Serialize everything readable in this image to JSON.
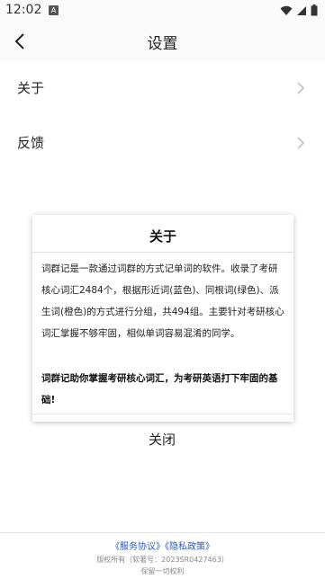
{
  "status_bar": {
    "time": "12:02",
    "notification_icon": "A"
  },
  "nav": {
    "title": "设置",
    "back_icon": "chevron-left-icon"
  },
  "menu": {
    "items": [
      {
        "label": "关于"
      },
      {
        "label": "反馈"
      }
    ]
  },
  "dialog": {
    "title": "关于",
    "body": "词群记是一款通过词群的方式记单词的软件。收录了考研核心词汇2484个，根据形近词(蓝色)、同根词(绿色)、派生词(橙色)的方式进行分组，共494组。主要针对考研核心词汇掌握不够牢固，相似单词容易混淆的同学。",
    "highlight": "词群记助你掌握考研核心词汇，为考研英语打下牢固的基础!",
    "close_label": "关闭"
  },
  "footer": {
    "service_link": "《服务协议》",
    "privacy_link": "《隐私政策》",
    "copyright": "版权所有（软著号：2023SR0427463）",
    "rights": "保留一切权利"
  }
}
